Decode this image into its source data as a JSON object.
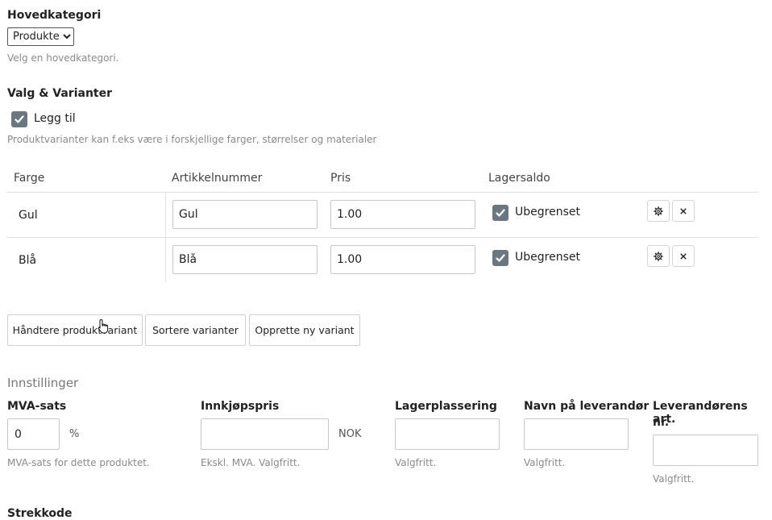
{
  "main_category": {
    "label": "Hovedkategori",
    "selected": "Produkter",
    "help": "Velg en hovedkategori."
  },
  "variants": {
    "section_title": "Valg & Varianter",
    "add_label": "Legg til",
    "add_checked": true,
    "help": "Produktvarianter kan f.eks være i forskjellige farger, størrelser og materialer",
    "columns": [
      "Farge",
      "Artikkelnummer",
      "Pris",
      "Lagersaldo"
    ],
    "rows": [
      {
        "color": "Gul",
        "article_number": "Gul",
        "price": "1.00",
        "stock_label": "Ubegrenset",
        "stock_checked": true
      },
      {
        "color": "Blå",
        "article_number": "Blå",
        "price": "1.00",
        "stock_label": "Ubegrenset",
        "stock_checked": true
      }
    ],
    "buttons": {
      "manage": "Håndtere produktvariant",
      "sort": "Sortere varianter",
      "create": "Opprette ny variant"
    }
  },
  "settings": {
    "title": "Innstillinger",
    "vat": {
      "label": "MVA-sats",
      "value": "0",
      "unit": "%",
      "help": "MVA-sats for dette produktet."
    },
    "purchase_price": {
      "label": "Innkjøpspris",
      "value": "",
      "unit": "NOK",
      "help": "Ekskl. MVA. Valgfritt."
    },
    "stock_location": {
      "label": "Lagerplassering",
      "value": "",
      "help": "Valgfritt."
    },
    "supplier_name": {
      "label": "Navn på leverandør",
      "value": "",
      "help": "Valgfritt."
    },
    "supplier_article": {
      "label_line1": "Leverandørens art.",
      "label_line2": "nr.",
      "value": "",
      "help": "Valgfritt."
    }
  },
  "barcode": {
    "label": "Strekkode"
  }
}
